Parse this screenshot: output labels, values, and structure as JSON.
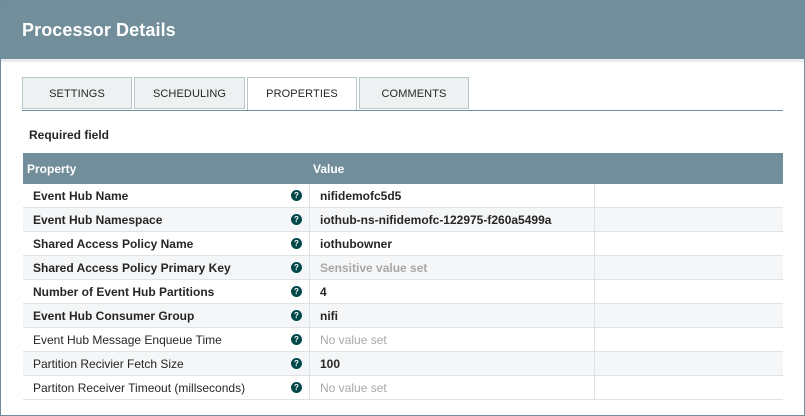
{
  "dialog": {
    "title": "Processor Details"
  },
  "tabs": [
    {
      "label": "SETTINGS"
    },
    {
      "label": "SCHEDULING"
    },
    {
      "label": "PROPERTIES",
      "active": true
    },
    {
      "label": "COMMENTS"
    }
  ],
  "required_note": "Required field",
  "table": {
    "headers": {
      "property": "Property",
      "value": "Value"
    },
    "rows": [
      {
        "name": "Event Hub Name",
        "value": "nifidemofc5d5",
        "required": true,
        "value_state": "set"
      },
      {
        "name": "Event Hub Namespace",
        "value": "iothub-ns-nifidemofc-122975-f260a5499a",
        "required": true,
        "value_state": "set"
      },
      {
        "name": "Shared Access Policy Name",
        "value": "iothubowner",
        "required": true,
        "value_state": "set"
      },
      {
        "name": "Shared Access Policy Primary Key",
        "value": "Sensitive value set",
        "required": true,
        "value_state": "sensitive"
      },
      {
        "name": "Number of Event Hub Partitions",
        "value": "4",
        "required": true,
        "value_state": "set"
      },
      {
        "name": "Event Hub Consumer Group",
        "value": "nifi",
        "required": true,
        "value_state": "set"
      },
      {
        "name": "Event Hub Message Enqueue Time",
        "value": "No value set",
        "required": false,
        "value_state": "empty"
      },
      {
        "name": "Partition Recivier Fetch Size",
        "value": "100",
        "required": false,
        "value_state": "set"
      },
      {
        "name": "Partiton Receiver Timeout (millseconds)",
        "value": "No value set",
        "required": false,
        "value_state": "empty"
      }
    ]
  },
  "colors": {
    "header": "#728e9b",
    "help_icon": "#004849"
  }
}
